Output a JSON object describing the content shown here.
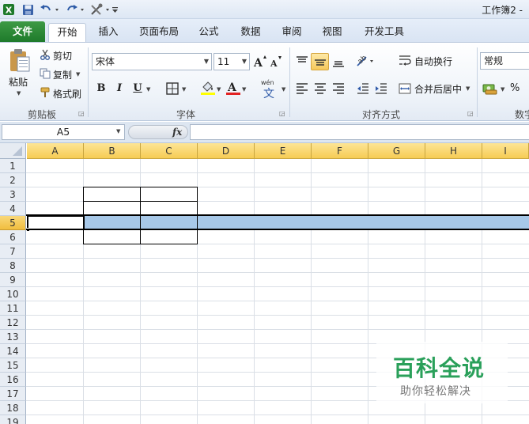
{
  "window": {
    "title": "工作簿2 -"
  },
  "ribbon_tabs": [
    "文件",
    "开始",
    "插入",
    "页面布局",
    "公式",
    "数据",
    "审阅",
    "视图",
    "开发工具"
  ],
  "clipboard": {
    "paste": "粘贴",
    "cut": "剪切",
    "copy": "复制",
    "format_painter": "格式刷",
    "group_label": "剪贴板"
  },
  "font": {
    "name": "宋体",
    "size": "11",
    "group_label": "字体",
    "bold": "B",
    "italic": "I",
    "underline": "U",
    "wen": "wén",
    "wen_char": "文"
  },
  "alignment": {
    "wrap_text": "自动换行",
    "merge_center": "合并后居中",
    "group_label": "对齐方式"
  },
  "number": {
    "format": "常规",
    "group_label_partial": "数字",
    "percent": "%"
  },
  "formula_bar": {
    "name_box": "A5",
    "fx": "fx",
    "formula": ""
  },
  "sheet": {
    "columns": [
      "A",
      "B",
      "C",
      "D",
      "E",
      "F",
      "G",
      "H",
      "I"
    ],
    "rows": [
      "1",
      "2",
      "3",
      "4",
      "5",
      "6",
      "7",
      "8",
      "9",
      "10",
      "11",
      "12",
      "13",
      "14",
      "15",
      "16",
      "17",
      "18",
      "19"
    ],
    "active_cell": "A5",
    "selected_row": "5"
  },
  "colors": {
    "excel_green": "#1e7a2b",
    "header_selected": "#f6cc54",
    "row_selection": "#a7c8e8",
    "watermark_green": "#2aa05a"
  },
  "watermark": {
    "main": "百科全说",
    "sub": "助你轻松解决"
  }
}
